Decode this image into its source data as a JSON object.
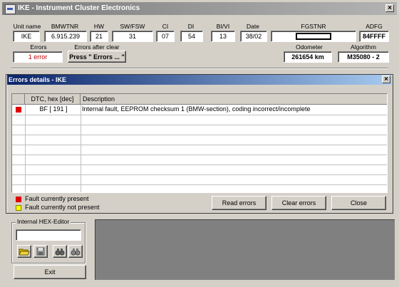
{
  "main": {
    "title": "IKE - Instrument Cluster Electronics",
    "fields": [
      {
        "label": "Unit name",
        "value": "IKE"
      },
      {
        "label": "BMWTNR",
        "value": "6.915.239"
      },
      {
        "label": "HW",
        "value": "21"
      },
      {
        "label": "SW/FSW",
        "value": "31"
      },
      {
        "label": "CI",
        "value": "07"
      },
      {
        "label": "DI",
        "value": "54"
      },
      {
        "label": "BI/VI",
        "value": "13"
      },
      {
        "label": "Date",
        "value": "38/02"
      },
      {
        "label": "FGSTNR",
        "value": ""
      },
      {
        "label": "ADFG",
        "value": "84FFFF"
      }
    ],
    "errors_label": "Errors",
    "errors_value": "1 error",
    "errors_after_clear_label": "Errors after clear",
    "errors_after_clear_button": "Press \" Errors ... \"",
    "odometer_label": "Odometer",
    "odometer_value": "261654 km",
    "algorithm_label": "Algorithm",
    "algorithm_value": "M35080 - 2"
  },
  "dialog": {
    "title": "Errors details - IKE",
    "columns": [
      "DTC, hex [dec]",
      "Description"
    ],
    "rows": [
      {
        "dtc": "BF [ 191 ]",
        "description": "Internal fault, EEPROM checksum 1 (BMW-section), coding incorrect/incomplete",
        "status": "present"
      }
    ],
    "legend": [
      {
        "label": "Fault currently present",
        "color": "#e00000"
      },
      {
        "label": "Fault currently not present",
        "color": "#ffff00"
      }
    ],
    "buttons": {
      "read": "Read errors",
      "clear": "Clear errors",
      "close": "Close"
    }
  },
  "hex_editor": {
    "title": "Internal HEX-Editor",
    "input_value": "",
    "tools": [
      "open-folder-icon",
      "save-disk-icon",
      "find-binoculars-icon",
      "find-next-binoculars-icon"
    ]
  },
  "exit_label": "Exit",
  "colors": {
    "present": "#e00000",
    "not_present": "#ffff00",
    "dialog_title": "#0a246a"
  }
}
